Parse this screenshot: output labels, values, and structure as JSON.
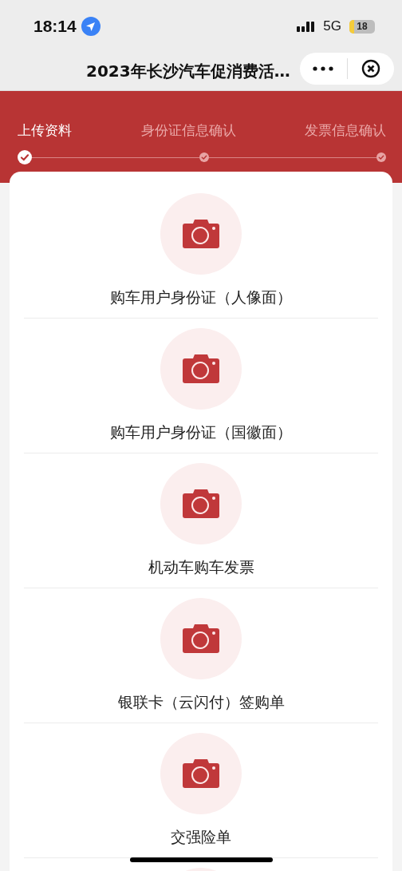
{
  "status_bar": {
    "time": "18:14",
    "network": "5G",
    "battery": "18"
  },
  "nav_bar": {
    "title": "2023年长沙汽车促消费活…"
  },
  "steps": [
    {
      "label": "上传资料",
      "selected": true
    },
    {
      "label": "身份证信息确认",
      "selected": false
    },
    {
      "label": "发票信息确认",
      "selected": false
    }
  ],
  "uploads": [
    {
      "kind": "labeled",
      "label": "购车用户身份证（人像面）"
    },
    {
      "kind": "labeled",
      "label": "购车用户身份证（国徽面）"
    },
    {
      "kind": "labeled",
      "label": "机动车购车发票"
    },
    {
      "kind": "labeled",
      "label": "银联卡（云闪付）签购单"
    },
    {
      "kind": "labeled",
      "label": "交强险单"
    },
    {
      "kind": "cut_off"
    }
  ]
}
